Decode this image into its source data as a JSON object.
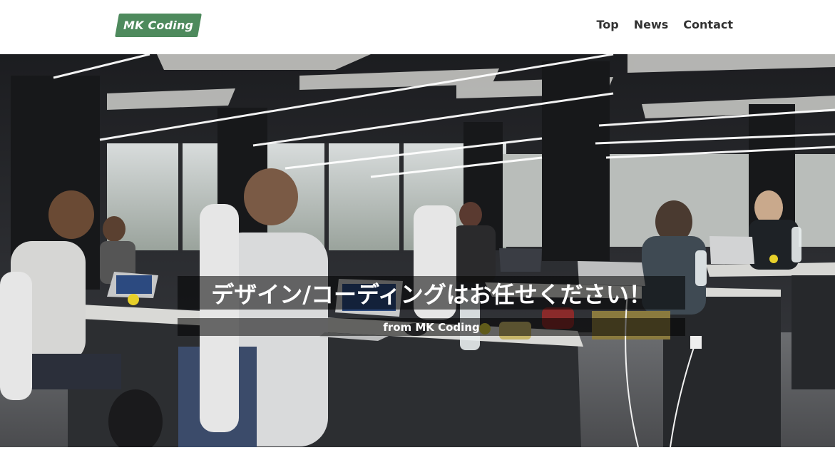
{
  "header": {
    "logo_text": "MK Coding",
    "nav": [
      {
        "label": "Top"
      },
      {
        "label": "News"
      },
      {
        "label": "Contact"
      }
    ]
  },
  "hero": {
    "title": "デザイン/コーディングはお任せください！",
    "subtitle": "from MK Coding",
    "image": "office-workspace-photo"
  },
  "colors": {
    "logo_bg": "#4e8a5d",
    "nav_text": "#333333",
    "overlay": "rgba(0,0,0,0.55)"
  }
}
